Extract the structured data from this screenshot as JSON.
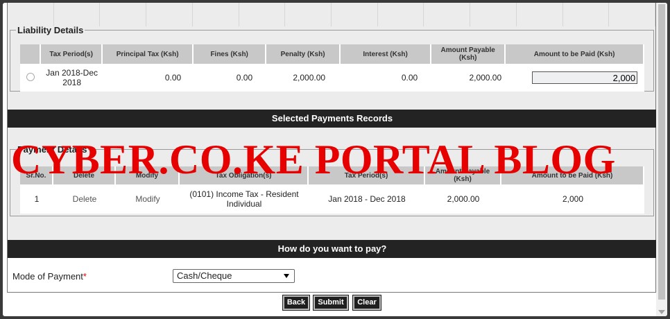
{
  "liability": {
    "legend": "Liability Details",
    "headers": [
      "Tax Period(s)",
      "Principal Tax (Ksh)",
      "Fines (Ksh)",
      "Penalty (Ksh)",
      "Interest (Ksh)",
      "Amount Payable (Ksh)",
      "Amount to be Paid (Ksh)"
    ],
    "row": {
      "period": "Jan 2018-Dec 2018",
      "principal": "0.00",
      "fines": "0.00",
      "penalty": "2,000.00",
      "interest": "0.00",
      "payable": "2,000.00",
      "to_pay": "2,000"
    }
  },
  "selected_bar": "Selected Payments Records",
  "payment": {
    "legend": "Payment Details",
    "headers": [
      "Sr.No.",
      "Delete",
      "Modify",
      "Tax Obligation(s)",
      "Tax Period(s)",
      "Amount Payable (Ksh)",
      "Amount to be Paid (Ksh)"
    ],
    "row": {
      "sr": "1",
      "delete": "Delete",
      "modify": "Modify",
      "obligation": "(0101) Income Tax - Resident Individual",
      "period": "Jan 2018 - Dec 2018",
      "payable": "2,000.00",
      "to_pay": "2,000"
    }
  },
  "pay_bar": "How do you want to pay?",
  "mode": {
    "label": "Mode of Payment",
    "required": "*",
    "selected": "Cash/Cheque"
  },
  "buttons": {
    "back": "Back",
    "submit": "Submit",
    "clear": "Clear"
  },
  "watermark": "CYBER.CO.KE PORTAL BLOG",
  "colors": {
    "accent_red": "#e60000",
    "bar": "#232323",
    "header_bg": "#c8c8c8"
  }
}
